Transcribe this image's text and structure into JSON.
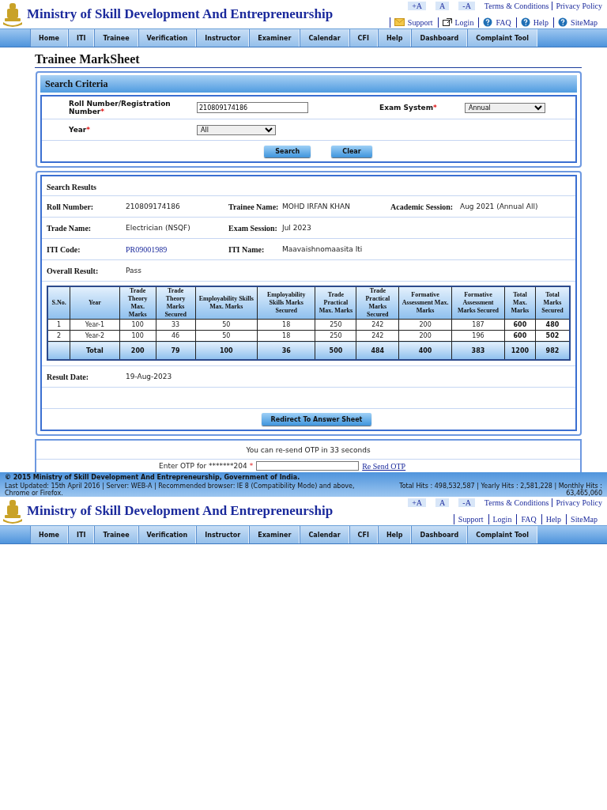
{
  "header": {
    "title": "Ministry of Skill Development And Entrepreneurship",
    "font_buttons": [
      "+A",
      "A",
      "-A"
    ],
    "top_links": [
      "Terms & Conditions",
      "Privacy Policy"
    ],
    "links": [
      {
        "label": "Support",
        "kind": "mail"
      },
      {
        "label": "Login",
        "kind": "window"
      },
      {
        "label": "FAQ",
        "kind": "help"
      },
      {
        "label": "Help",
        "kind": "help"
      },
      {
        "label": "SiteMap",
        "kind": "help"
      }
    ]
  },
  "nav": [
    "Home",
    "ITI",
    "Trainee",
    "Verification",
    "Instructor",
    "Examiner",
    "Calendar",
    "CFI",
    "Help",
    "Dashboard",
    "Complaint Tool"
  ],
  "page_title": "Trainee MarkSheet",
  "search_criteria": {
    "title": "Search Criteria",
    "fields": [
      {
        "label": "Roll Number/Registration Number",
        "mark": "*",
        "kind": "text",
        "value": "210809174186"
      },
      {
        "label": "Exam System",
        "mark": "*",
        "kind": "select",
        "value": "Annual"
      },
      {
        "label": "Year",
        "mark": "*",
        "kind": "select",
        "value": "All"
      }
    ],
    "buttons": [
      "Search",
      "Clear"
    ]
  },
  "results": {
    "title": "Search Results",
    "info_rows": [
      [
        {
          "label": "Roll Number:",
          "value": "210809174186",
          "kind": "text"
        },
        {
          "label": "Trainee Name:",
          "value": "MOHD IRFAN KHAN",
          "kind": "text"
        },
        {
          "label": "Academic Session:",
          "value": "Aug 2021 (Annual All)",
          "kind": "text"
        }
      ],
      [
        {
          "label": "Trade Name:",
          "value": "Electrician (NSQF)",
          "kind": "text"
        },
        {
          "label": "Exam Session:",
          "value": "Jul 2023",
          "kind": "text"
        }
      ],
      [
        {
          "label": "ITI Code:",
          "value": "PR09001989",
          "kind": "link"
        },
        {
          "label": "ITI Name:",
          "value": "Maavaishnomaasita Iti",
          "kind": "text"
        }
      ],
      [
        {
          "label": "Overall Result:",
          "value": "Pass",
          "kind": "text"
        }
      ]
    ],
    "table": {
      "columns": [
        "S.No.",
        "Year",
        "Trade Theory Max. Marks",
        "Trade Theory Marks Secured",
        "Employability Skills Max. Marks",
        "Employability Skills Marks Secured",
        "Trade Practical Max. Marks",
        "Trade Practical Marks Secured",
        "Formative Assessment Max. Marks",
        "Formative Assessment Marks Secured",
        "Total Max. Marks",
        "Total Marks Secured"
      ],
      "rows": [
        [
          "1",
          "Year-1",
          "100",
          "33",
          "50",
          "18",
          "250",
          "242",
          "200",
          "187",
          "600",
          "480"
        ],
        [
          "2",
          "Year-2",
          "100",
          "46",
          "50",
          "18",
          "250",
          "242",
          "200",
          "196",
          "600",
          "502"
        ]
      ],
      "total": [
        "Total",
        "200",
        "79",
        "100",
        "36",
        "500",
        "484",
        "400",
        "383",
        "1200",
        "982"
      ]
    },
    "result_date": {
      "label": "Result Date:",
      "value": "19-Aug-2023"
    },
    "button": "Redirect To Answer Sheet"
  },
  "otp": {
    "message": "You can re-send OTP in 33 seconds",
    "label": "Enter OTP for *******204",
    "mark": "*",
    "link": "Re Send OTP"
  },
  "footer": {
    "copyright": "© 2015 Ministry of Skill Development And Entrepreneurship, Government of India.",
    "info": "Last Updated: 15th April 2016 | Server: WEB-A | Recommended browser: IE 8 (Compatibility Mode) and above, Chrome or Firefox.",
    "hits": "Total Hits : 498,532,587 | Yearly Hits : 2,581,228 | Monthly Hits : 63,465,060"
  },
  "header_repeat": {
    "title": "Ministry of Skill Development And Entrepreneurship",
    "font_buttons": [
      "+A",
      "A",
      "-A"
    ],
    "top_links": [
      "Terms & Conditions",
      "Privacy Policy"
    ],
    "links": [
      {
        "label": "Support"
      },
      {
        "label": "Login"
      },
      {
        "label": "FAQ"
      },
      {
        "label": "Help"
      },
      {
        "label": "SiteMap"
      }
    ]
  },
  "nav_repeat": [
    "Home",
    "ITI",
    "Trainee",
    "Verification",
    "Instructor",
    "Examiner",
    "Calendar",
    "CFI",
    "Help",
    "Dashboard",
    "Complaint Tool"
  ]
}
